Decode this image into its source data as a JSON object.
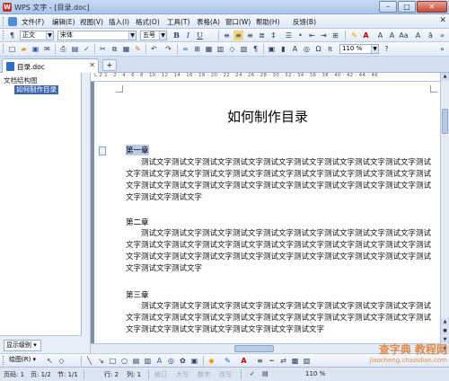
{
  "window": {
    "title": "WPS 文字 - [目录.doc]",
    "app_icon_letter": "W",
    "close": "✕",
    "minimize": "–",
    "maximize": "□"
  },
  "menu": {
    "items": [
      "文件(F)",
      "编辑(E)",
      "视图(V)",
      "插入(I)",
      "格式(O)",
      "工具(T)",
      "表格(A)",
      "窗口(W)",
      "帮助(H)",
      "反馈(B)"
    ],
    "close_doc": "✕"
  },
  "format_toolbar": {
    "style": "正文",
    "font": "宋体",
    "size": "五号",
    "bold": "B",
    "italic": "I",
    "underline": "U",
    "zoom": "110 %"
  },
  "tabs": {
    "doc_name": "目录.doc",
    "close": "✕"
  },
  "nav_pane": {
    "title": "文档结构图",
    "item": "如何制作目录",
    "level_button": "显示级别"
  },
  "ruler_text": "L 2 1 · 2 · 4 · 6 · 8 · 10 · 12 · 14 · 16 · 18 · 20 · 22 · 24 · 26 · 28 · 30 · 32 · 34 · 36 · 38 · 40 · 42 · 44 · 46",
  "document": {
    "title": "如何制作目录",
    "chapters": [
      {
        "heading": "第一章",
        "text": "测试文字测试文字测试文字测试文字测试文字测试文字测试文字测试文字测试文字测试文字测试文字测试文字测试文字测试文字测试文字测试文字测试文字测试文字测试文字测试文字测试文字测试文字测试文字测试文字测试文字测试文字测试文字测试文字测试文字测试文字测试文字测试文字"
      },
      {
        "heading": "第二章",
        "text": "测试文字测试文字测试文字测试文字测试文字测试文字测试文字测试文字测试文字测试文字测试文字测试文字测试文字测试文字测试文字测试文字测试文字测试文字测试文字测试文字测试文字测试文字测试文字测试文字测试文字测试文字测试文字测试文字测试文字测试文字测试文字测试文字"
      },
      {
        "heading": "第三章",
        "text": "测试文字测试文字测试文字测试文字测试文字测试文字测试文字测试文字测试文字测试文字测试文字测试文字测试文字测试文字测试文字测试文字测试文字测试文字测试文字测试文字测试文字测试文字测试文字测试文字测试文字测试文字"
      }
    ]
  },
  "draw_toolbar": {
    "label": "绘图(R)"
  },
  "status": {
    "page": "页码: 1",
    "pages": "页: 1/2",
    "section": "节: 1/1",
    "row": "行: 2",
    "col": "列: 1",
    "rev": "修订",
    "caps": "大写",
    "num": "数字",
    "ovr": "改写",
    "zoom": "110 %"
  },
  "watermark": {
    "line1": "查字典 教程网",
    "line2": "jiaocheng.chazidian.com"
  }
}
